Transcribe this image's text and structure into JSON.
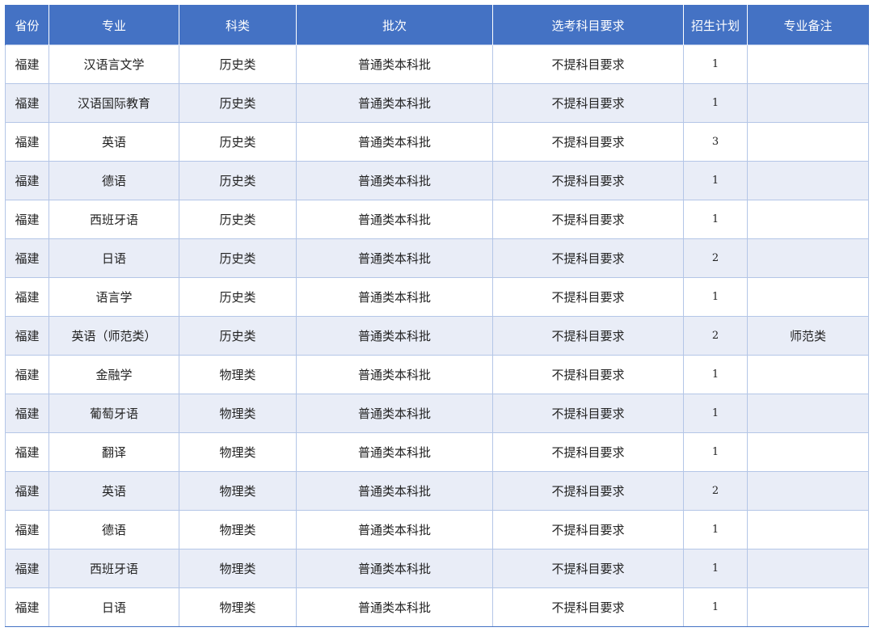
{
  "table": {
    "headers": [
      "省份",
      "专业",
      "科类",
      "批次",
      "选考科目要求",
      "招生计划",
      "专业备注"
    ],
    "rows": [
      [
        "福建",
        "汉语言文学",
        "历史类",
        "普通类本科批",
        "不提科目要求",
        "1",
        ""
      ],
      [
        "福建",
        "汉语国际教育",
        "历史类",
        "普通类本科批",
        "不提科目要求",
        "1",
        ""
      ],
      [
        "福建",
        "英语",
        "历史类",
        "普通类本科批",
        "不提科目要求",
        "3",
        ""
      ],
      [
        "福建",
        "德语",
        "历史类",
        "普通类本科批",
        "不提科目要求",
        "1",
        ""
      ],
      [
        "福建",
        "西班牙语",
        "历史类",
        "普通类本科批",
        "不提科目要求",
        "1",
        ""
      ],
      [
        "福建",
        "日语",
        "历史类",
        "普通类本科批",
        "不提科目要求",
        "2",
        ""
      ],
      [
        "福建",
        "语言学",
        "历史类",
        "普通类本科批",
        "不提科目要求",
        "1",
        ""
      ],
      [
        "福建",
        "英语（师范类）",
        "历史类",
        "普通类本科批",
        "不提科目要求",
        "2",
        "师范类"
      ],
      [
        "福建",
        "金融学",
        "物理类",
        "普通类本科批",
        "不提科目要求",
        "1",
        ""
      ],
      [
        "福建",
        "葡萄牙语",
        "物理类",
        "普通类本科批",
        "不提科目要求",
        "1",
        ""
      ],
      [
        "福建",
        "翻译",
        "物理类",
        "普通类本科批",
        "不提科目要求",
        "1",
        ""
      ],
      [
        "福建",
        "英语",
        "物理类",
        "普通类本科批",
        "不提科目要求",
        "2",
        ""
      ],
      [
        "福建",
        "德语",
        "物理类",
        "普通类本科批",
        "不提科目要求",
        "1",
        ""
      ],
      [
        "福建",
        "西班牙语",
        "物理类",
        "普通类本科批",
        "不提科目要求",
        "1",
        ""
      ],
      [
        "福建",
        "日语",
        "物理类",
        "普通类本科批",
        "不提科目要求",
        "1",
        ""
      ]
    ]
  },
  "colors": {
    "header_bg": "#4472c4",
    "header_text": "#ffffff",
    "stripe_bg": "#e9edf7",
    "border": "#b4c6e7"
  }
}
